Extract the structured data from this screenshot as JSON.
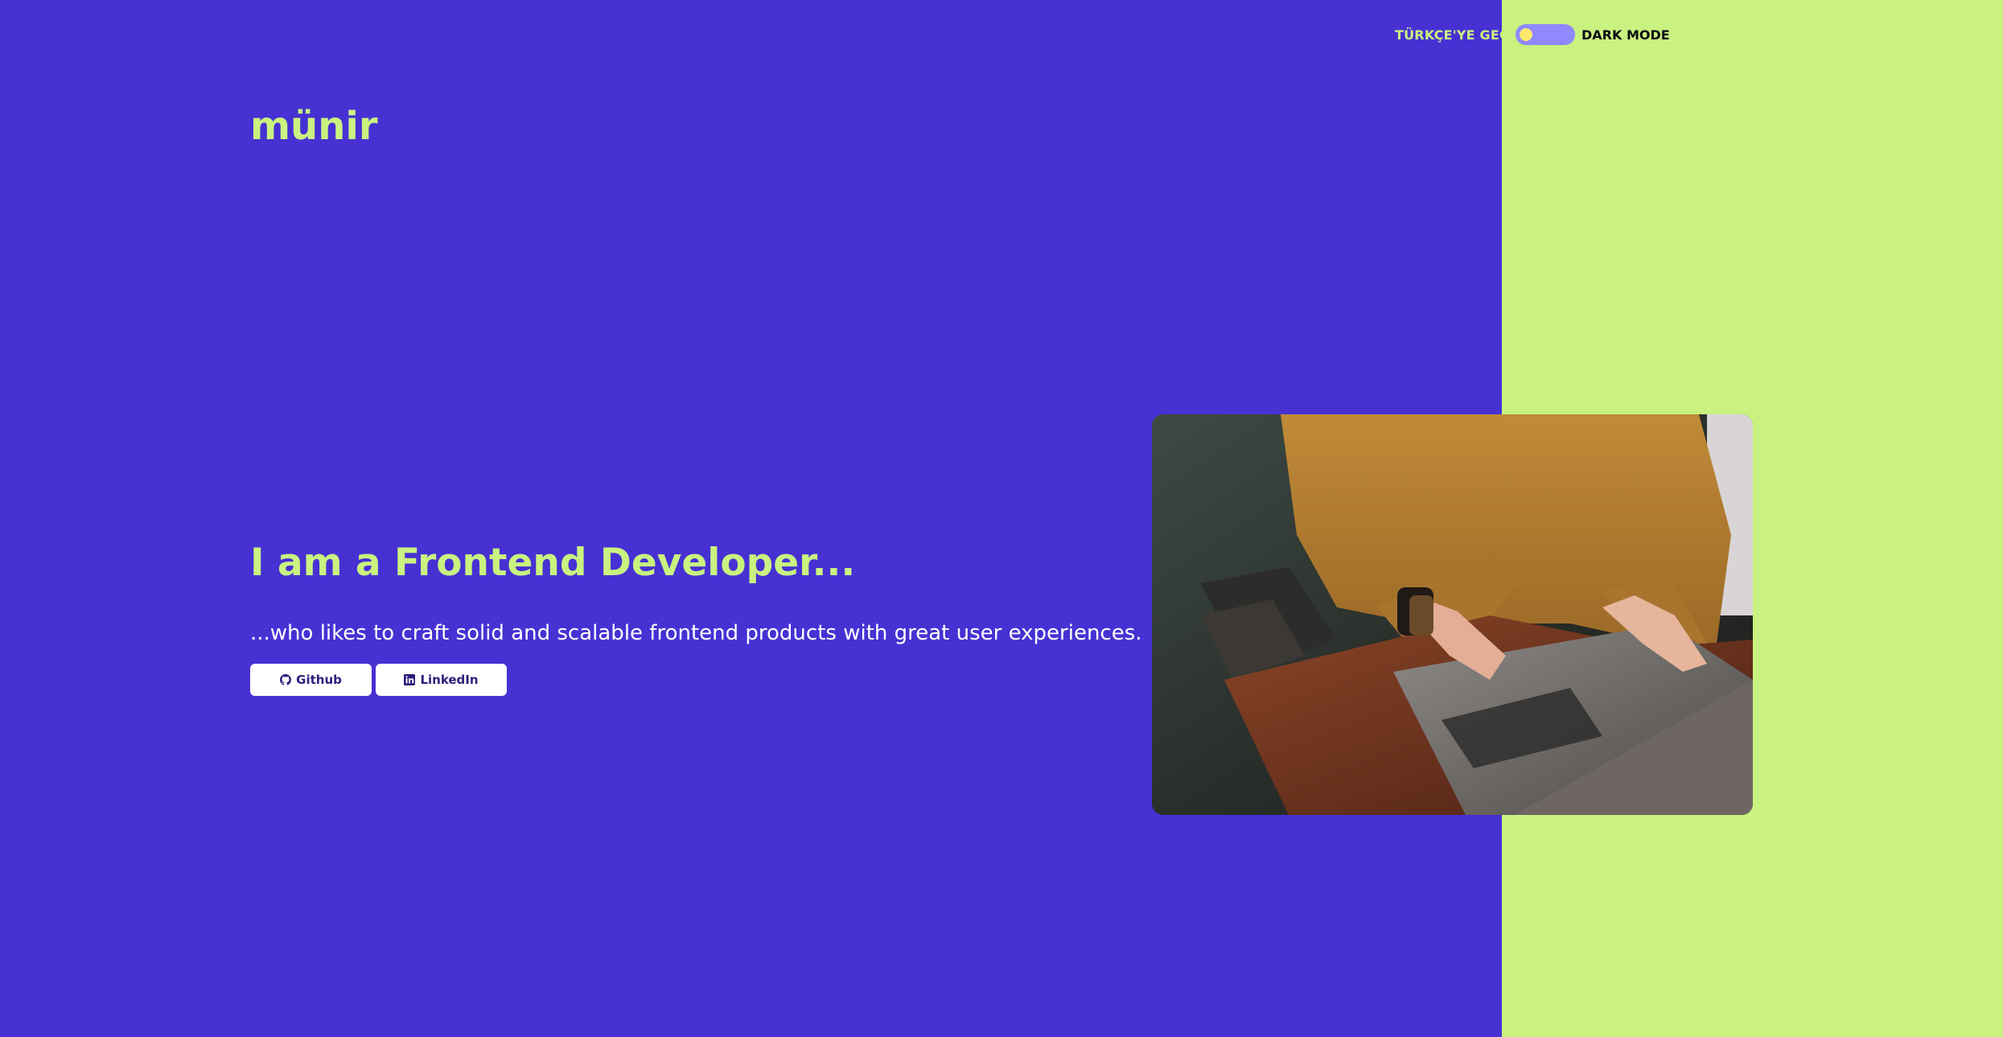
{
  "header": {
    "language_switch_label": "TÜRKÇE'YE GEÇ",
    "dark_mode_label": "DARK MODE",
    "dark_mode_on": false
  },
  "brand": {
    "logo_text": "münir"
  },
  "hero": {
    "headline": "I am a Frontend Developer...",
    "tagline": "...who likes to craft solid and scalable frontend products with great user experiences.",
    "buttons": [
      {
        "label": "Github",
        "icon": "github-icon"
      },
      {
        "label": "LinkedIn",
        "icon": "linkedin-icon"
      }
    ],
    "photo_alt": "person in a mustard sweater typing on a laptop"
  },
  "colors": {
    "primary_bg": "#4731d3",
    "accent": "#c9f280",
    "toggle_track": "#8f88ff",
    "toggle_knob": "#ffe86e"
  }
}
